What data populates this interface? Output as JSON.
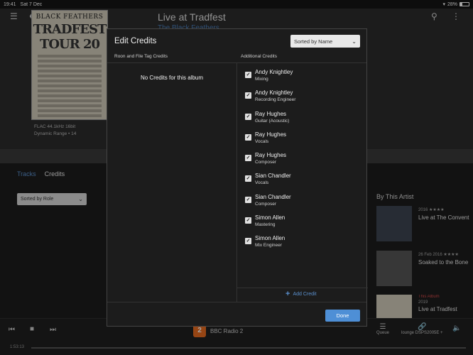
{
  "status_bar": {
    "time": "19:41",
    "date": "Sat 7 Dec",
    "battery": "28%"
  },
  "background": {
    "album_title": "Live at Tradfest",
    "album_artist": "The Black Feathers",
    "album_art_text": {
      "band": "BLACK FEATHERS",
      "tour": "TRADFEST TOUR 20"
    },
    "format": "FLAC 44.1kHz 16bit",
    "dynamic_range": "Dynamic Range • 14",
    "tabs": [
      "Tracks",
      "Credits"
    ],
    "sort_select": "Sorted by Role",
    "right_heading": "By This Artist",
    "artist_items": [
      {
        "meta": "2016 ★★★★",
        "name": "Live at The Convent"
      },
      {
        "meta": "26 Feb 2016 ★★★★",
        "name": "Soaked to the Bone"
      },
      {
        "tag": "This Album",
        "meta": "2019",
        "name": "Live at Tradfest"
      }
    ]
  },
  "player": {
    "now_playing": "BBC Radio 2",
    "elapsed": "1:53:13",
    "queue_label": "Queue",
    "zone_label": "lounge DSPS2005E +"
  },
  "modal": {
    "title": "Edit Credits",
    "sort_value": "Sorted by Name",
    "left_header": "Roon and File Tag Credits",
    "right_header": "Additional Credits",
    "empty_message": "No Credits for this album",
    "credits": [
      {
        "name": "Andy Knightley",
        "role": "Mixing"
      },
      {
        "name": "Andy Knightley",
        "role": "Recording Engineer"
      },
      {
        "name": "Ray Hughes",
        "role": "Guitar (Acoustic)"
      },
      {
        "name": "Ray Hughes",
        "role": "Vocals"
      },
      {
        "name": "Ray Hughes",
        "role": "Composer"
      },
      {
        "name": "Sian Chandler",
        "role": "Vocals"
      },
      {
        "name": "Sian Chandler",
        "role": "Composer"
      },
      {
        "name": "Simon Allen",
        "role": "Mastering"
      },
      {
        "name": "Simon Allen",
        "role": "Mix Engineer"
      }
    ],
    "add_credit_label": "Add Credit",
    "done_label": "Done"
  }
}
